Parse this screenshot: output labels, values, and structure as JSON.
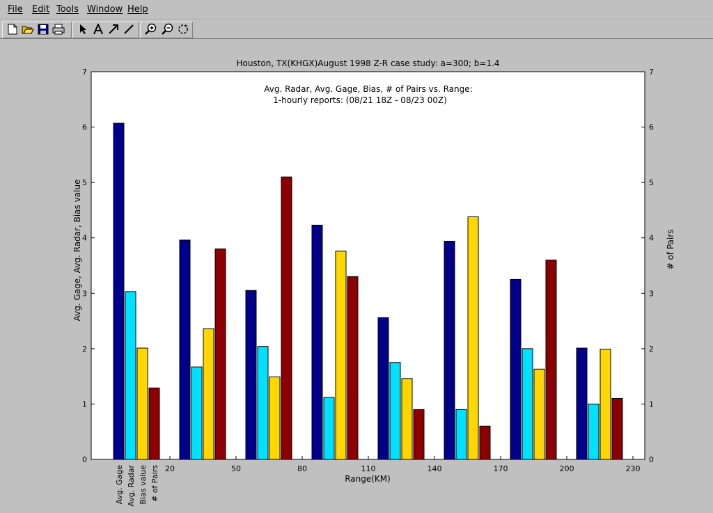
{
  "menu": {
    "items": [
      "File",
      "Edit",
      "Tools",
      "Window",
      "Help"
    ]
  },
  "toolbar": {
    "icons": [
      "new-file-icon",
      "open-folder-icon",
      "save-icon",
      "print-icon",
      "arrow-pointer-icon",
      "text-tool-icon",
      "arrow-tool-icon",
      "line-tool-icon",
      "zoom-in-icon",
      "zoom-out-icon",
      "rotate-icon"
    ]
  },
  "chart_data": {
    "type": "bar",
    "title": "Houston, TX(KHGX)August 1998 Z-R case study: a=300; b=1.4",
    "subtitle_lines": [
      "Avg. Radar, Avg. Gage, Bias, # of Pairs vs. Range:",
      "1-hourly reports: (08/21 18Z - 08/23 00Z)"
    ],
    "xlabel": "Range(KM)",
    "ylabel": "Avg. Gage, Avg. Radar, Bias value",
    "ylabel_right": "# of Pairs",
    "ylim": [
      0,
      7
    ],
    "yticks": [
      0,
      1,
      2,
      3,
      4,
      5,
      6,
      7
    ],
    "xticks": [
      "20",
      "50",
      "80",
      "110",
      "140",
      "170",
      "200",
      "230"
    ],
    "legend_labels": [
      "Avg. Gage",
      "Avg. Radar",
      "Bias value",
      "# of Pairs"
    ],
    "legend_placement": "below-left-vertical",
    "grid": false,
    "series": [
      {
        "name": "Avg. Gage",
        "color": "#00008b",
        "values": [
          6.07,
          3.96,
          3.05,
          4.23,
          2.56,
          3.94,
          3.25,
          2.01
        ]
      },
      {
        "name": "Avg. Radar",
        "color": "#00e0ff",
        "values": [
          3.03,
          1.67,
          2.04,
          1.12,
          1.75,
          0.9,
          2.0,
          1.0
        ]
      },
      {
        "name": "Bias value",
        "color": "#ffd700",
        "values": [
          2.01,
          2.36,
          1.49,
          3.76,
          1.46,
          4.38,
          1.63,
          1.99
        ]
      },
      {
        "name": "# of Pairs",
        "color": "#8b0000",
        "values": [
          1.29,
          3.8,
          5.1,
          3.3,
          0.9,
          0.6,
          3.6,
          1.1
        ]
      }
    ]
  }
}
